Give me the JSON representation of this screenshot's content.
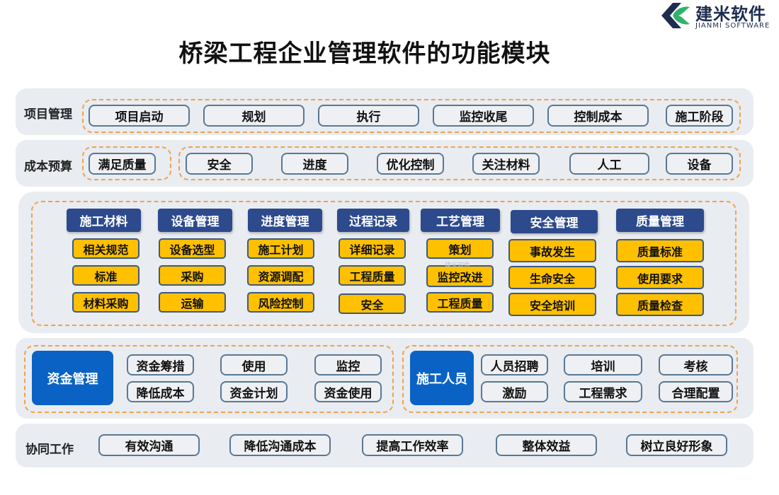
{
  "logo": {
    "name_cn": "建米软件",
    "name_en": "JIANMI SOFTWARE",
    "colors": {
      "dark": "#1d2d50",
      "green": "#2fb26a"
    }
  },
  "title": "桥梁工程企业管理软件的功能模块",
  "project_management": {
    "label": "项目管理",
    "items": [
      "项目启动",
      "规划",
      "执行",
      "监控收尾",
      "控制成本",
      "施工阶段"
    ]
  },
  "cost_budget": {
    "label": "成本预算",
    "group1": [
      "满足质量"
    ],
    "group2": [
      "安全",
      "进度",
      "优化控制",
      "关注材料",
      "人工",
      "设备"
    ]
  },
  "modules": [
    {
      "header": "施工材料",
      "items": [
        "相关规范",
        "标准",
        "材料采购"
      ]
    },
    {
      "header": "设备管理",
      "items": [
        "设备选型",
        "采购",
        "运输"
      ]
    },
    {
      "header": "进度管理",
      "items": [
        "施工计划",
        "资源调配",
        "风险控制"
      ]
    },
    {
      "header": "过程记录",
      "items": [
        "详细记录",
        "工程质量",
        "安全"
      ]
    },
    {
      "header": "工艺管理",
      "items": [
        "策划",
        "监控改进",
        "工程质量"
      ]
    },
    {
      "header": "安全管理",
      "items": [
        "事故发生",
        "生命安全",
        "安全培训"
      ]
    },
    {
      "header": "质量管理",
      "items": [
        "质量标准",
        "使用要求",
        "质量检查"
      ]
    }
  ],
  "watermark": "建米软件",
  "funds": {
    "title": "资金管理",
    "items": [
      "资金筹措",
      "使用",
      "监控",
      "降低成本",
      "资金计划",
      "资金使用"
    ]
  },
  "personnel": {
    "title": "施工人员",
    "items": [
      "人员招聘",
      "培训",
      "考核",
      "激励",
      "工程需求",
      "合理配置"
    ]
  },
  "collaboration": {
    "label": "协同工作",
    "items": [
      "有效沟通",
      "降低沟通成本",
      "提高工作效率",
      "整体效益",
      "树立良好形象"
    ]
  },
  "colors": {
    "band_bg": "#e9ecf1",
    "dashed_border": "#f0a24a",
    "pill_border": "#5a7894",
    "module_header": "#2c4a8c",
    "module_item": "#ffc000",
    "primary_blue": "#0a63c4"
  }
}
